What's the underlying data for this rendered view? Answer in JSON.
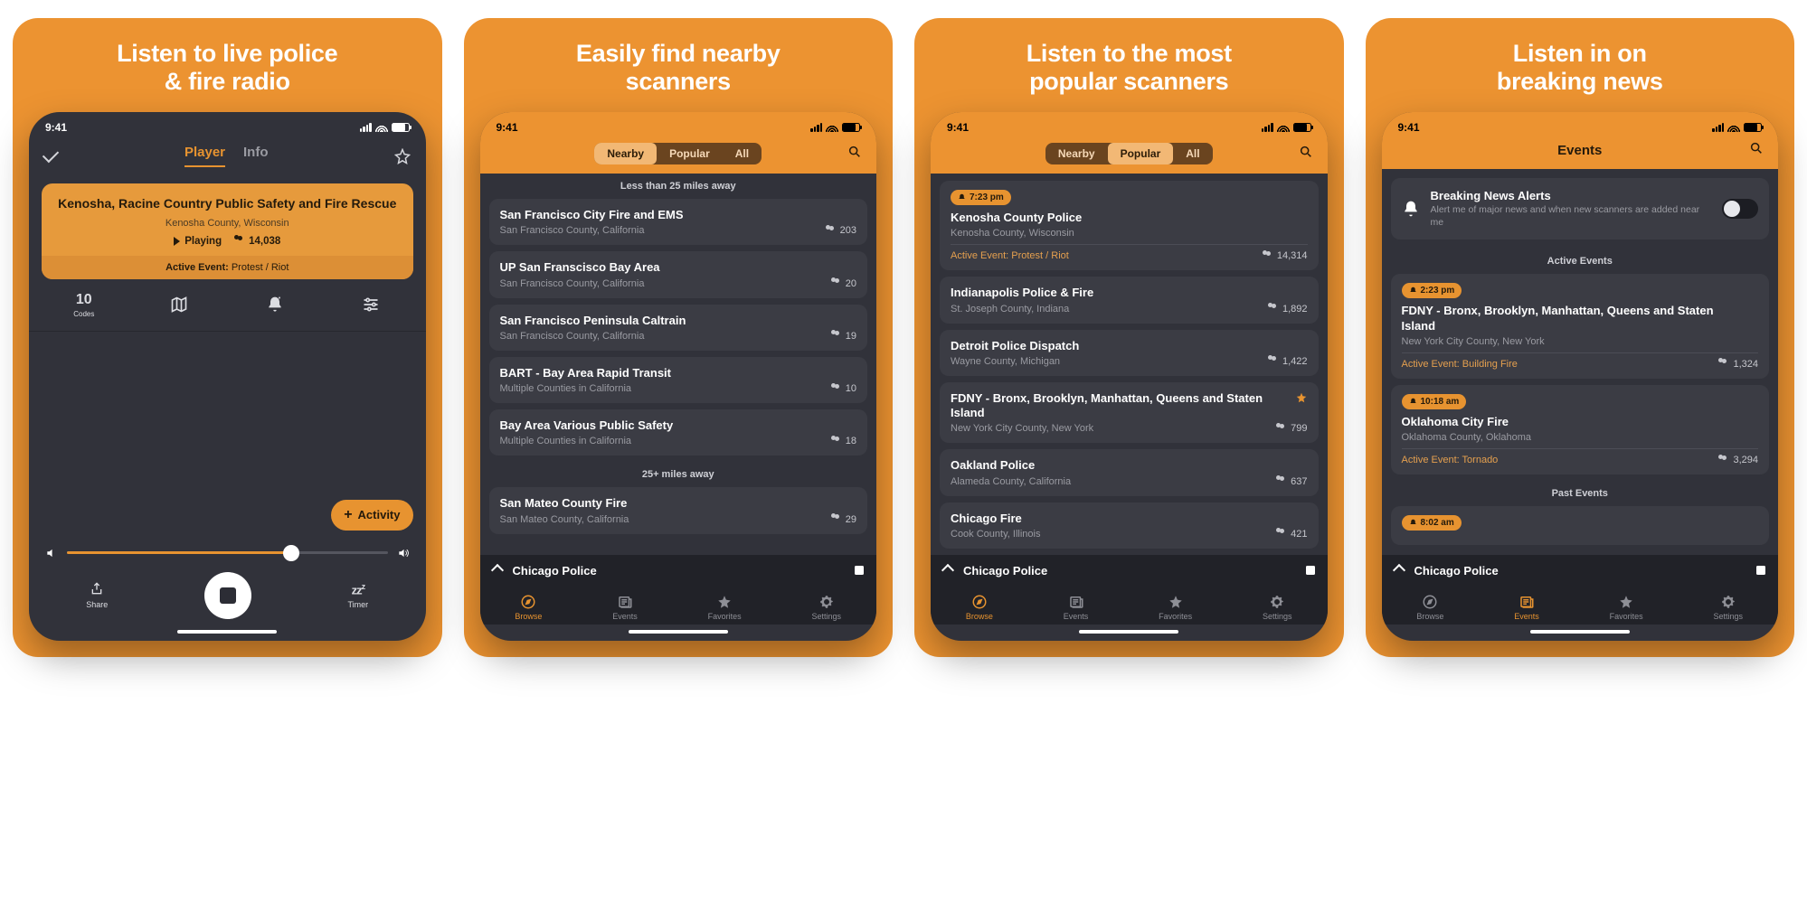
{
  "status_time": "9:41",
  "screen1": {
    "headline_l1": "Listen to live police",
    "headline_l2": "& fire radio",
    "tab_player": "Player",
    "tab_info": "Info",
    "now_title": "Kenosha, Racine Country Public Safety and Fire Rescue",
    "now_sub": "Kenosha County, Wisconsin",
    "playing": "Playing",
    "listeners": "14,038",
    "event_lbl": "Active Event:",
    "event_val": "Protest / Riot",
    "codes_n": "10",
    "codes_lbl": "Codes",
    "fab": "Activity",
    "share": "Share",
    "timer": "Timer"
  },
  "screen2": {
    "headline_l1": "Easily find nearby",
    "headline_l2": "scanners",
    "seg_nearby": "Nearby",
    "seg_popular": "Popular",
    "seg_all": "All",
    "d1": "Less than 25 miles away",
    "d2": "25+ miles away",
    "items": [
      {
        "t": "San Francisco City Fire and EMS",
        "s": "San Francisco County, California",
        "n": "203"
      },
      {
        "t": "UP San Franscisco Bay Area",
        "s": "San Francisco County, California",
        "n": "20"
      },
      {
        "t": "San Francisco Peninsula Caltrain",
        "s": "San Francisco County, California",
        "n": "19"
      },
      {
        "t": "BART - Bay Area Rapid Transit",
        "s": "Multiple Counties in California",
        "n": "10"
      },
      {
        "t": "Bay Area Various Public Safety",
        "s": "Multiple Counties in California",
        "n": "18"
      }
    ],
    "item6": {
      "t": "San Mateo County Fire",
      "s": "San Mateo County, California",
      "n": "29"
    }
  },
  "screen3": {
    "headline_l1": "Listen to the most",
    "headline_l2": "popular scanners",
    "top": {
      "badge": "7:23 pm",
      "t": "Kenosha County Police",
      "s": "Kenosha County, Wisconsin",
      "n": "14,314",
      "ev": "Active Event: Protest / Riot"
    },
    "items": [
      {
        "t": "Indianapolis Police & Fire",
        "s": "St. Joseph County, Indiana",
        "n": "1,892"
      },
      {
        "t": "Detroit Police Dispatch",
        "s": "Wayne County, Michigan",
        "n": "1,422"
      },
      {
        "t": "FDNY - Bronx, Brooklyn, Manhattan, Queens and Staten Island",
        "s": "New York City County, New York",
        "n": "799",
        "star": true
      },
      {
        "t": "Oakland Police",
        "s": "Alameda County, California",
        "n": "637"
      },
      {
        "t": "Chicago Fire",
        "s": "Cook County, Illinois",
        "n": "421"
      }
    ]
  },
  "screen4": {
    "headline_l1": "Listen in on",
    "headline_l2": "breaking news",
    "title": "Events",
    "alert_t": "Breaking News Alerts",
    "alert_s": "Alert me of major news and when new scanners are added near me",
    "sec_active": "Active Events",
    "sec_past": "Past Events",
    "e1": {
      "badge": "2:23 pm",
      "t": "FDNY - Bronx, Brooklyn, Manhattan, Queens and Staten Island",
      "s": "New York City County, New York",
      "n": "1,324",
      "ev": "Active Event: Building Fire"
    },
    "e2": {
      "badge": "10:18 am",
      "t": "Oklahoma City Fire",
      "s": "Oklahoma County, Oklahoma",
      "n": "3,294",
      "ev": "Active Event: Tornado"
    },
    "e3": {
      "badge": "8:02 am"
    }
  },
  "mini": {
    "t": "Chicago Police"
  },
  "tabs": {
    "browse": "Browse",
    "events": "Events",
    "fav": "Favorites",
    "settings": "Settings"
  }
}
